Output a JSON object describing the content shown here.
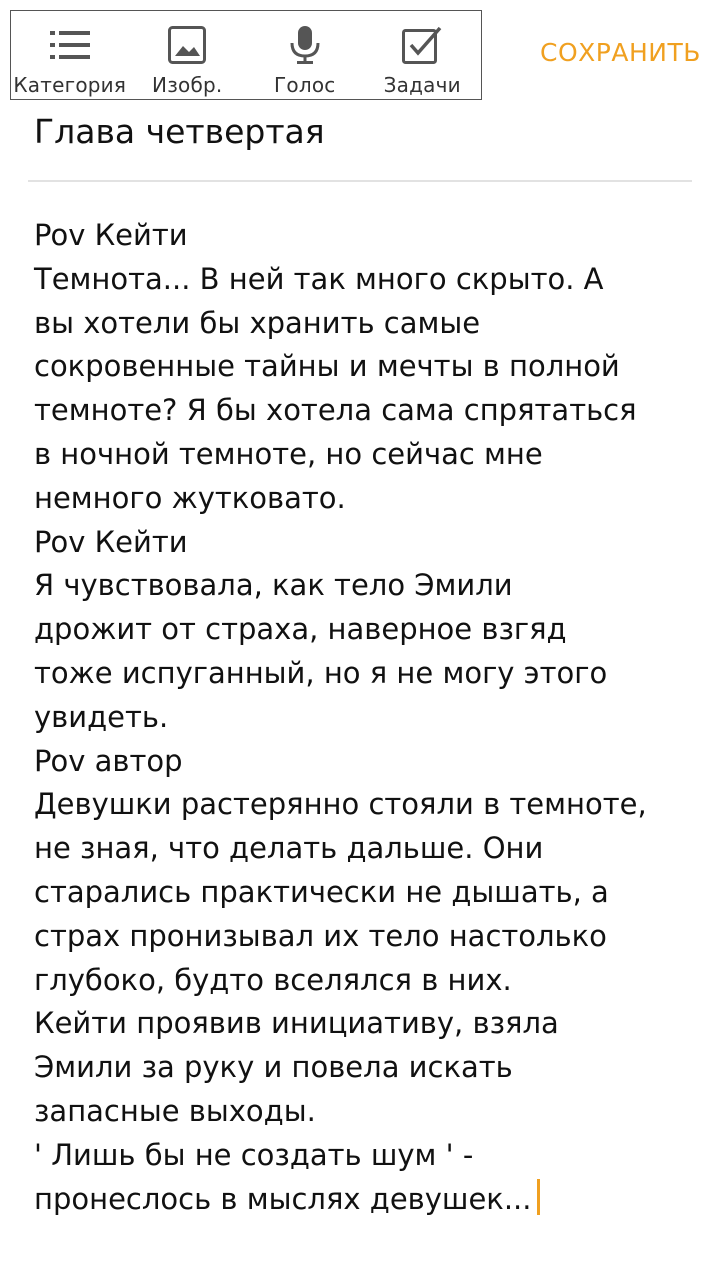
{
  "toolbar": {
    "items": [
      {
        "label": "Категория",
        "icon": "list-icon"
      },
      {
        "label": "Изобр.",
        "icon": "image-icon"
      },
      {
        "label": "Голос",
        "icon": "microphone-icon"
      },
      {
        "label": "Задачи",
        "icon": "checkbox-icon"
      }
    ],
    "save_label": "СОХРАНИТЬ"
  },
  "note": {
    "title": "Глава четвертая",
    "lines": [
      "Pov Кейти",
      "Темнота... В ней так много скрыто. А",
      "вы хотели бы хранить самые",
      "сокровенные тайны и мечты в полной",
      "темноте? Я бы хотела сама спрятаться",
      "в ночной темноте, но сейчас мне",
      "немного жутковато.",
      "Pov Кейти",
      "Я чувствовала, как тело Эмили",
      "дрожит от страха, наверное взгяд",
      "тоже испуганный, но я не могу этого",
      "увидеть.",
      "Pov автор",
      "Девушки растерянно стояли в темноте,",
      "не зная, что делать дальше. Они",
      "старались практически не дышать, а",
      "страх пронизывал их тело настолько",
      "глубоко, будто вселялся в них.",
      "Кейти проявив инициативу, взяла",
      "Эмили за руку и повела искать",
      "запасные выходы.",
      "' Лишь бы не создать шум ' -",
      "пронеслось в мыслях девушек..."
    ]
  },
  "colors": {
    "accent": "#f0a020",
    "toolbar_border": "#555555",
    "divider": "#e2e2e2"
  }
}
